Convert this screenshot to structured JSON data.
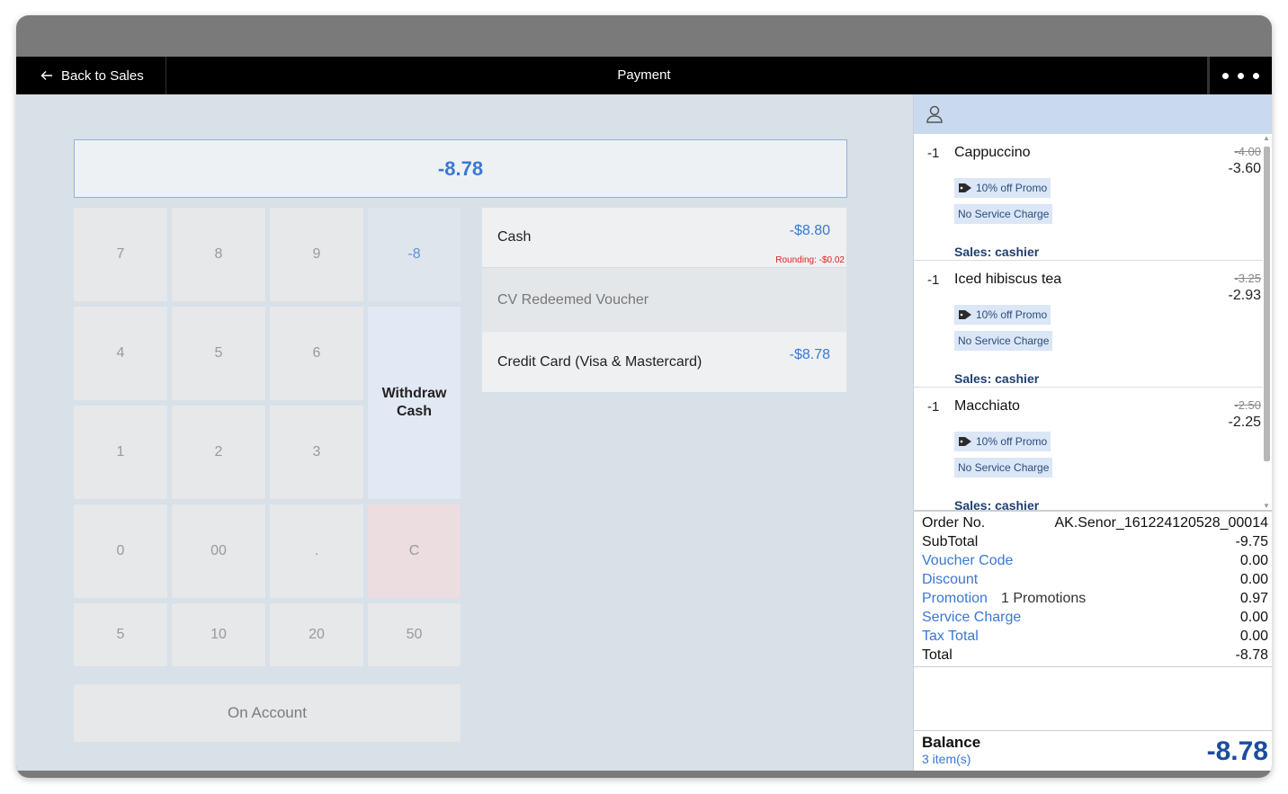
{
  "topbar": {
    "back_label": "Back to Sales",
    "title": "Payment"
  },
  "amount_display": "-8.78",
  "keypad": {
    "keys": [
      "7",
      "8",
      "9",
      "-8",
      "4",
      "5",
      "6",
      "Withdraw Cash",
      "1",
      "2",
      "3",
      "0",
      "00",
      ".",
      "C",
      "5",
      "10",
      "20",
      "50"
    ]
  },
  "on_account_label": "On Account",
  "payments": [
    {
      "label": "Cash",
      "amount": "-$8.80",
      "rounding": "Rounding: -$0.02"
    },
    {
      "label": "CV Redeemed Voucher",
      "amount": ""
    },
    {
      "label": "Credit Card (Visa & Mastercard)",
      "amount": "-$8.78"
    }
  ],
  "items": [
    {
      "qty": "-1",
      "name": "Cappuccino",
      "original_price": "-4.00",
      "price": "-3.60",
      "promo": "10% off Promo",
      "service": "No Service Charge",
      "sales": "Sales: cashier"
    },
    {
      "qty": "-1",
      "name": "Iced hibiscus tea",
      "original_price": "-3.25",
      "price": "-2.93",
      "promo": "10% off Promo",
      "service": "No Service Charge",
      "sales": "Sales: cashier"
    },
    {
      "qty": "-1",
      "name": "Macchiato",
      "original_price": "-2.50",
      "price": "-2.25",
      "promo": "10% off Promo",
      "service": "No Service Charge",
      "sales": "Sales: cashier"
    }
  ],
  "summary": {
    "order_no_label": "Order No.",
    "order_no": "AK.Senor_161224120528_00014",
    "subtotal_label": "SubTotal",
    "subtotal": "-9.75",
    "voucher_label": "Voucher Code",
    "voucher": "0.00",
    "discount_label": "Discount",
    "discount": "0.00",
    "promotion_label": "Promotion",
    "promotion_count": "1 Promotions",
    "promotion": "0.97",
    "service_label": "Service Charge",
    "service": "0.00",
    "tax_label": "Tax Total",
    "tax": "0.00",
    "total_label": "Total",
    "total": "-8.78"
  },
  "balance": {
    "label": "Balance",
    "items_count": "3 item(s)",
    "value": "-8.78"
  },
  "colors": {
    "accent": "#3a78d4",
    "balance": "#1a4d9e",
    "rounding": "#e0201f",
    "topbar": "#000000"
  }
}
